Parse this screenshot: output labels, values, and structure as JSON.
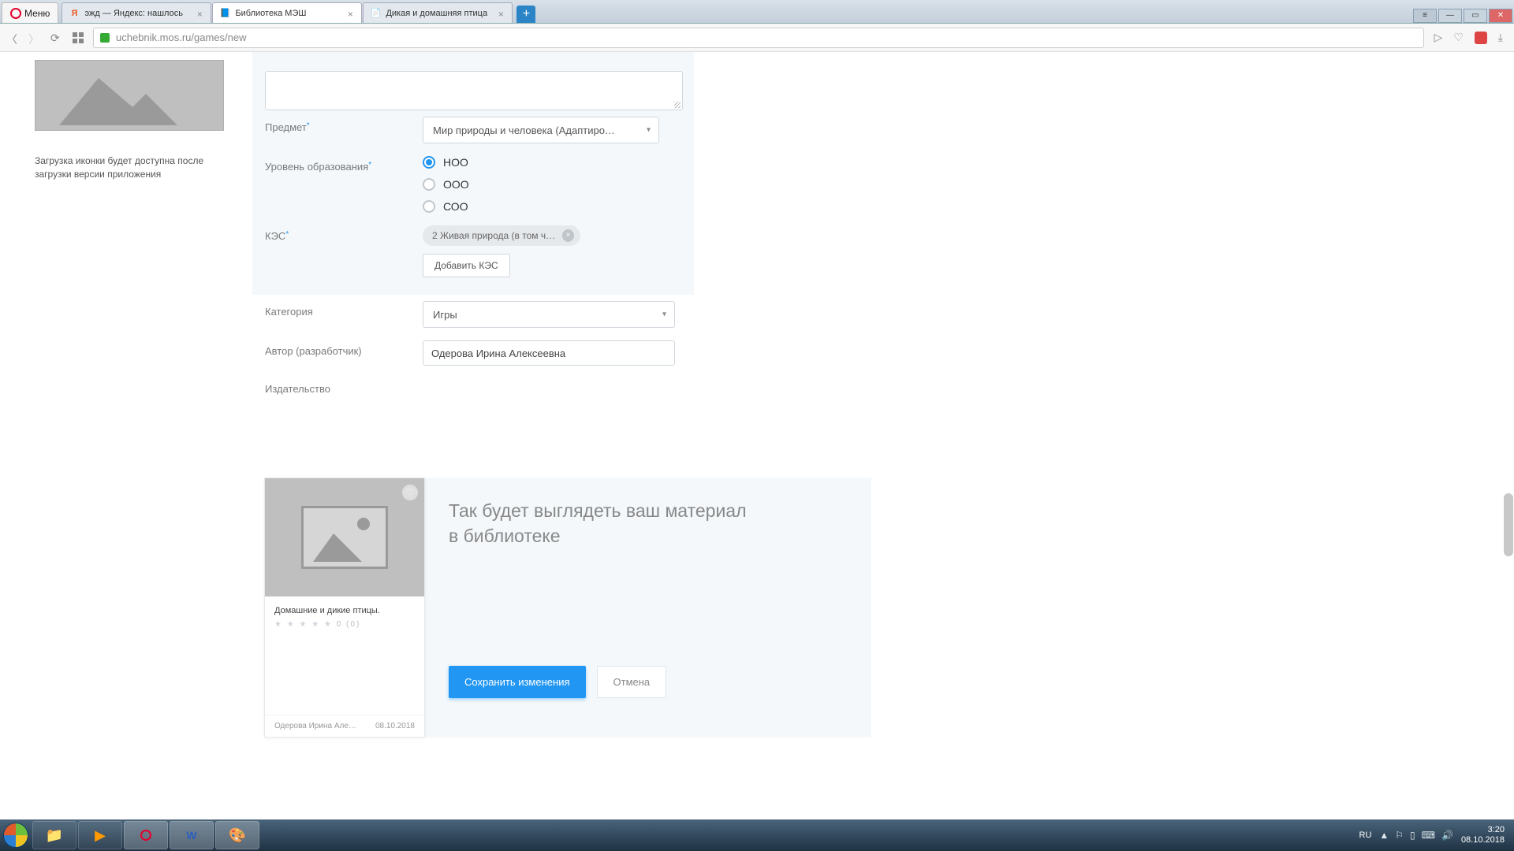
{
  "browser": {
    "menu_label": "Меню",
    "tabs": [
      {
        "favicon": "Я",
        "favcolor": "#e52",
        "title": "эжд — Яндекс: нашлось"
      },
      {
        "favicon": "📘",
        "favcolor": "#36c",
        "title": "Библиотека МЭШ",
        "active": true
      },
      {
        "favicon": "📄",
        "favcolor": "#888",
        "title": "Дикая и домашняя птица"
      }
    ],
    "url": "uchebnik.mos.ru/games/new"
  },
  "left": {
    "helper": "Загрузка иконки будет доступна после загрузки версии приложения"
  },
  "form": {
    "subject_label": "Предмет",
    "subject_value": "Мир природы и человека (Адаптиро…",
    "level_label": "Уровень образования",
    "levels": {
      "noo": "НОО",
      "ooo": "ООО",
      "soo": "СОО"
    },
    "kes_label": "КЭС",
    "kes_chip": "2 Живая природа (в том чис…",
    "kes_add": "Добавить КЭС",
    "category_label": "Категория",
    "category_value": "Игры",
    "author_label": "Автор (разработчик)",
    "author_value": "Одерова Ирина Алексеевна",
    "publisher_label": "Издательство"
  },
  "preview": {
    "heading_l1": "Так будет выглядеть ваш материал",
    "heading_l2": "в библиотеке",
    "card_title": "Домашние и дикие птицы.",
    "card_stars": "★ ★ ★ ★ ★",
    "card_rating": "0 (0)",
    "card_author": "Одерова Ирина Але…",
    "card_date": "08.10.2018",
    "btn_save": "Сохранить изменения",
    "btn_cancel": "Отмена"
  },
  "taskbar": {
    "lang": "RU",
    "time": "3:20",
    "date": "08.10.2018"
  }
}
